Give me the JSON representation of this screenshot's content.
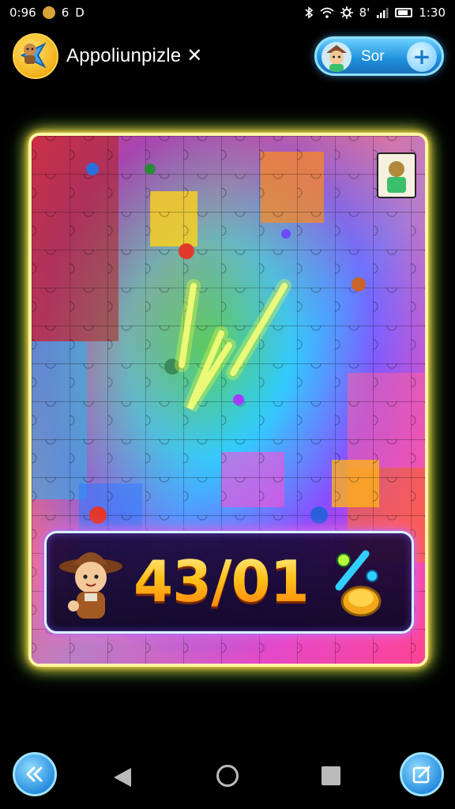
{
  "status_bar": {
    "time_left": "0:96",
    "notif_1": "6",
    "notif_2": "D",
    "signal_text": "8'",
    "clock": "1:30"
  },
  "header": {
    "app_title": "Appoliunpizle ✕",
    "profile_label": "Sor",
    "plus_symbol": "+"
  },
  "score": {
    "value": "43/01",
    "percent_symbol": "%"
  },
  "colors": {
    "accent_blue": "#2a8fe0",
    "frame_glow": "#ffe94a",
    "score_gold": "#ffc21a"
  },
  "icons": [
    "back-arrow-icon",
    "wifi-icon",
    "bluetooth-icon",
    "battery-icon",
    "plus-icon",
    "edit-icon",
    "home-icon",
    "recent-apps-icon"
  ]
}
